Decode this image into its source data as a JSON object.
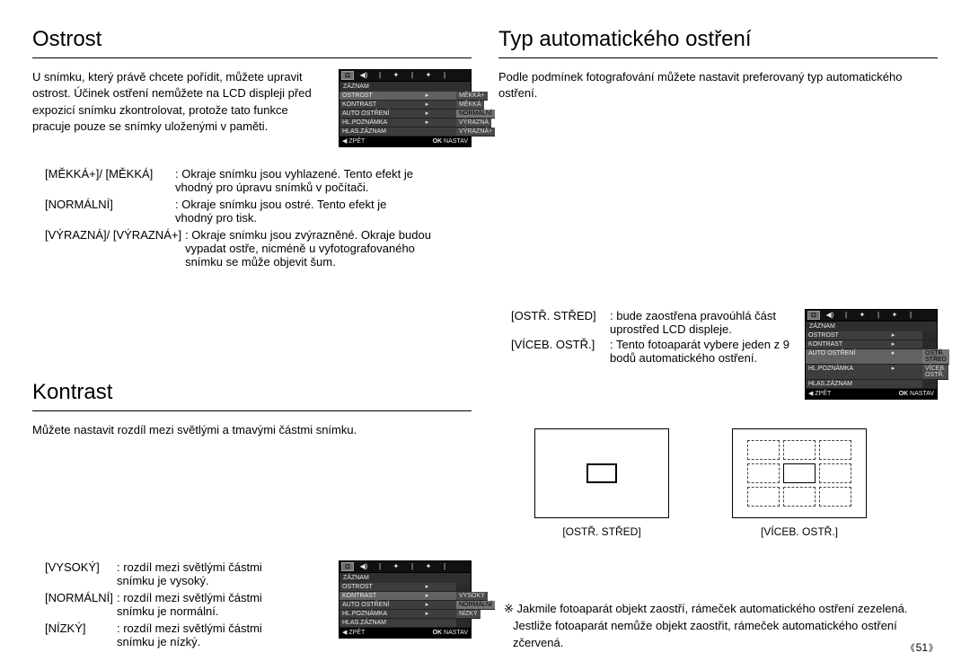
{
  "page_number": "51",
  "left": {
    "ostrost": {
      "title": "Ostrost",
      "intro": "U snímku, který právě chcete pořídit, můžete upravit ostrost. Účinek ostření nemůžete na LCD displeji před expozicí snímku zkontrolovat, protože tato funkce pracuje pouze se snímky uloženými v paměti.",
      "defs": [
        {
          "k": "[MĚKKÁ+]/ [MĚKKÁ]",
          "v": ": Okraje snímku jsou vyhlazené. Tento efekt je vhodný pro úpravu snímků v počítači."
        },
        {
          "k": "[NORMÁLNÍ]",
          "v": ": Okraje snímku jsou ostré. Tento efekt je vhodný pro tisk."
        },
        {
          "k": "[VÝRAZNÁ]/ [VÝRAZNÁ+]",
          "v": ": Okraje snímku jsou zvýrazněné. Okraje budou vypadat ostře, nicméně u vyfotografovaného snímku se může objevit šum."
        }
      ],
      "lcd": {
        "header": "ZÁZNAM",
        "rows": [
          {
            "l": "OSTROST",
            "r": "MĚKKÁ+",
            "arrow": true,
            "hi": true
          },
          {
            "l": "KONTRAST",
            "r": "MĚKKÁ",
            "hi": false
          },
          {
            "l": "AUTO OSTŘENÍ",
            "r": "NORMÁLNÍ",
            "hi": false,
            "rhi": true
          },
          {
            "l": "HL.POZNÁMKA",
            "r": "VÝRAZNÁ",
            "hi": false
          },
          {
            "l": "HLAS.ZÁZNAM",
            "r": "VÝRAZNÁ+",
            "hi": false
          }
        ],
        "footer_back_icon": "◀",
        "footer_back": "ZPĚT",
        "footer_ok": "OK",
        "footer_set": "NASTAV"
      }
    },
    "kontrast": {
      "title": "Kontrast",
      "intro": "Můžete nastavit rozdíl mezi světlými a tmavými částmi snímku.",
      "defs": [
        {
          "k": "[VYSOKÝ]",
          "v": ": rozdíl mezi světlými částmi snímku je vysoký."
        },
        {
          "k": "[NORMÁLNÍ]",
          "v": ": rozdíl mezi světlými částmi snímku je normální."
        },
        {
          "k": "[NÍZKÝ]",
          "v": ": rozdíl mezi světlými částmi snímku je nízký."
        }
      ],
      "lcd": {
        "header": "ZÁZNAM",
        "rows": [
          {
            "l": "OSTROST",
            "r": "",
            "arrow": true
          },
          {
            "l": "KONTRAST",
            "r": "VYSOKÝ",
            "hi": true
          },
          {
            "l": "AUTO OSTŘENÍ",
            "r": "NORMÁLNÍ",
            "rhi": true
          },
          {
            "l": "HL.POZNÁMKA",
            "r": "NÍZKÝ"
          },
          {
            "l": "HLAS.ZÁZNAM",
            "r": ""
          }
        ],
        "footer_back_icon": "◀",
        "footer_back": "ZPĚT",
        "footer_ok": "OK",
        "footer_set": "NASTAV"
      }
    }
  },
  "right": {
    "typ": {
      "title": "Typ automatického ostření",
      "intro": "Podle podmínek fotografování můžete nastavit preferovaný typ automatického ostření.",
      "defs": [
        {
          "k": "[OSTŘ. STŘED]",
          "v": ": bude zaostřena pravoúhlá část uprostřed LCD displeje."
        },
        {
          "k": "[VÍCEB. OSTŘ.]",
          "v": ": Tento fotoaparát vybere jeden z 9 bodů automatického ostření."
        }
      ],
      "lcd": {
        "header": "ZÁZNAM",
        "rows": [
          {
            "l": "OSTROST",
            "r": "",
            "arrow": true
          },
          {
            "l": "KONTRAST",
            "r": ""
          },
          {
            "l": "AUTO OSTŘENÍ",
            "r": "OSTŘ. STŘED",
            "hi": true,
            "rhi": true
          },
          {
            "l": "HL.POZNÁMKA",
            "r": "VÍCEB. OSTŘ."
          },
          {
            "l": "HLAS.ZÁZNAM",
            "r": ""
          }
        ],
        "footer_back_icon": "◀",
        "footer_back": "ZPĚT",
        "footer_ok": "OK",
        "footer_set": "NASTAV"
      },
      "diagram_labels": {
        "center": "[OSTŘ. STŘED]",
        "multi": "[VÍCEB. OSTŘ.]"
      },
      "note": "Jakmile fotoaparát objekt zaostří, rámeček automatického ostření zezelená. Jestliže fotoaparát nemůže objekt zaostřit, rámeček automatického ostření zčervená."
    }
  },
  "lcd_tabs": {
    "cam": "◘",
    "sound": "◀)",
    "sep": "|",
    "tool1": "✦",
    "tool2": "✦"
  }
}
